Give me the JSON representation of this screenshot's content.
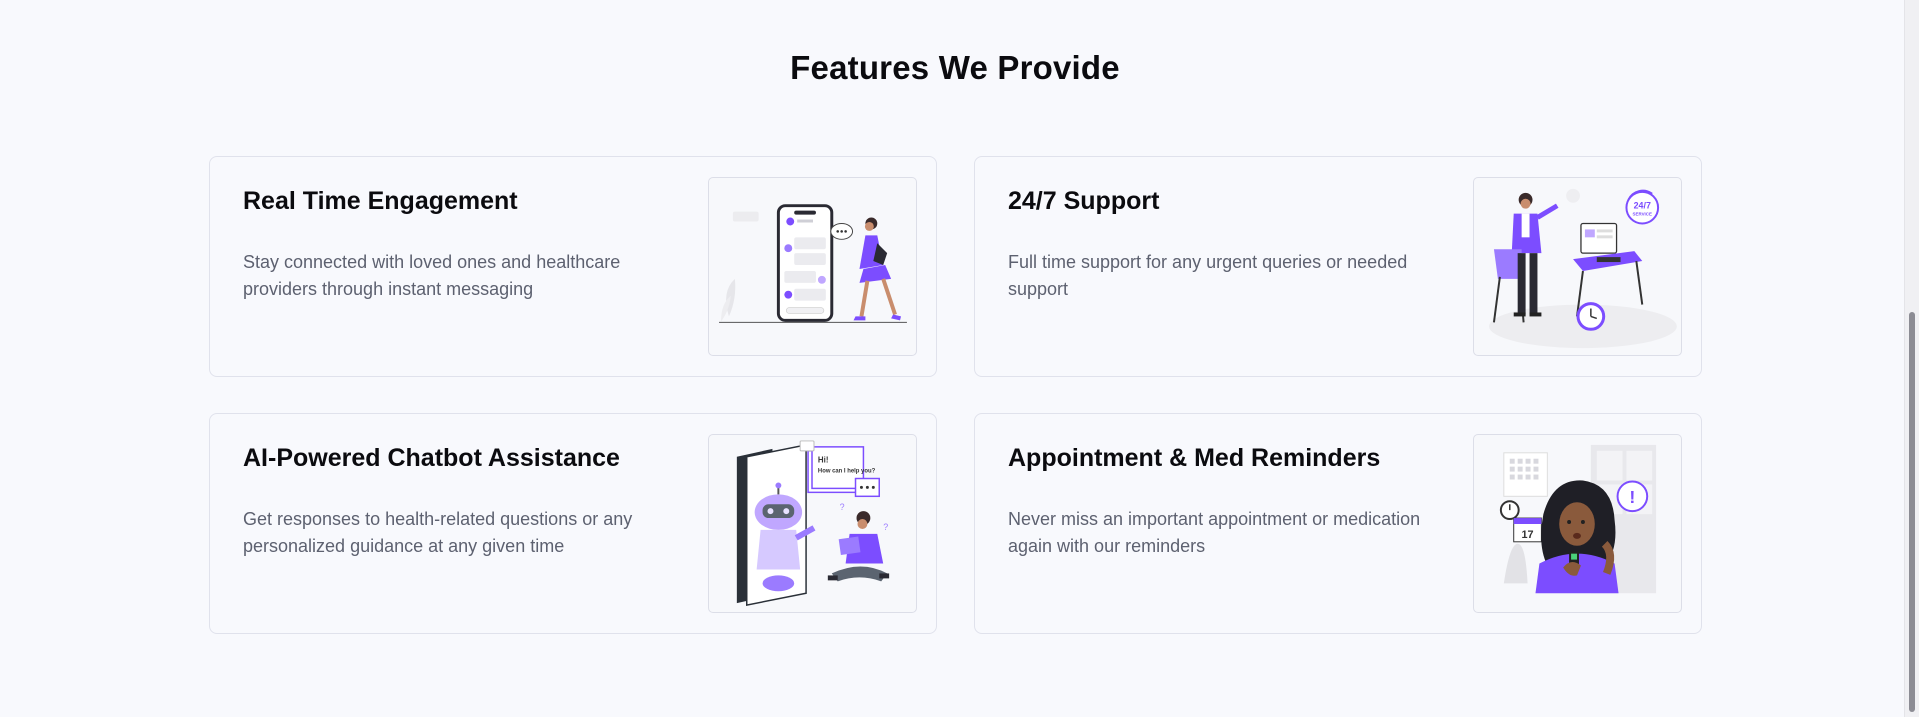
{
  "section": {
    "title": "Features We Provide"
  },
  "features": [
    {
      "title": "Real Time Engagement",
      "description": "Stay connected with loved ones and healthcare providers through instant messaging",
      "icon": "messaging-illustration-icon"
    },
    {
      "title": "24/7 Support",
      "description": "Full time support for any urgent queries or needed support",
      "icon": "support-desk-illustration-icon",
      "badge_line1": "24/7",
      "badge_line2": "SERVICE"
    },
    {
      "title": "AI-Powered Chatbot Assistance",
      "description": "Get responses to health-related questions or any personalized guidance at any given time",
      "icon": "chatbot-illustration-icon",
      "bubble_line1": "Hi!",
      "bubble_line2": "How can I help you?"
    },
    {
      "title": "Appointment & Med Reminders",
      "description": "Never miss an important appointment or medication again with our reminders",
      "icon": "reminder-illustration-icon",
      "calendar_day": "17",
      "alert_mark": "!"
    }
  ],
  "colors": {
    "accent": "#7c4dff",
    "background": "#f8f9fd",
    "border": "#e0e2ec",
    "text": "#0b0b0f",
    "muted": "#5d6170"
  }
}
